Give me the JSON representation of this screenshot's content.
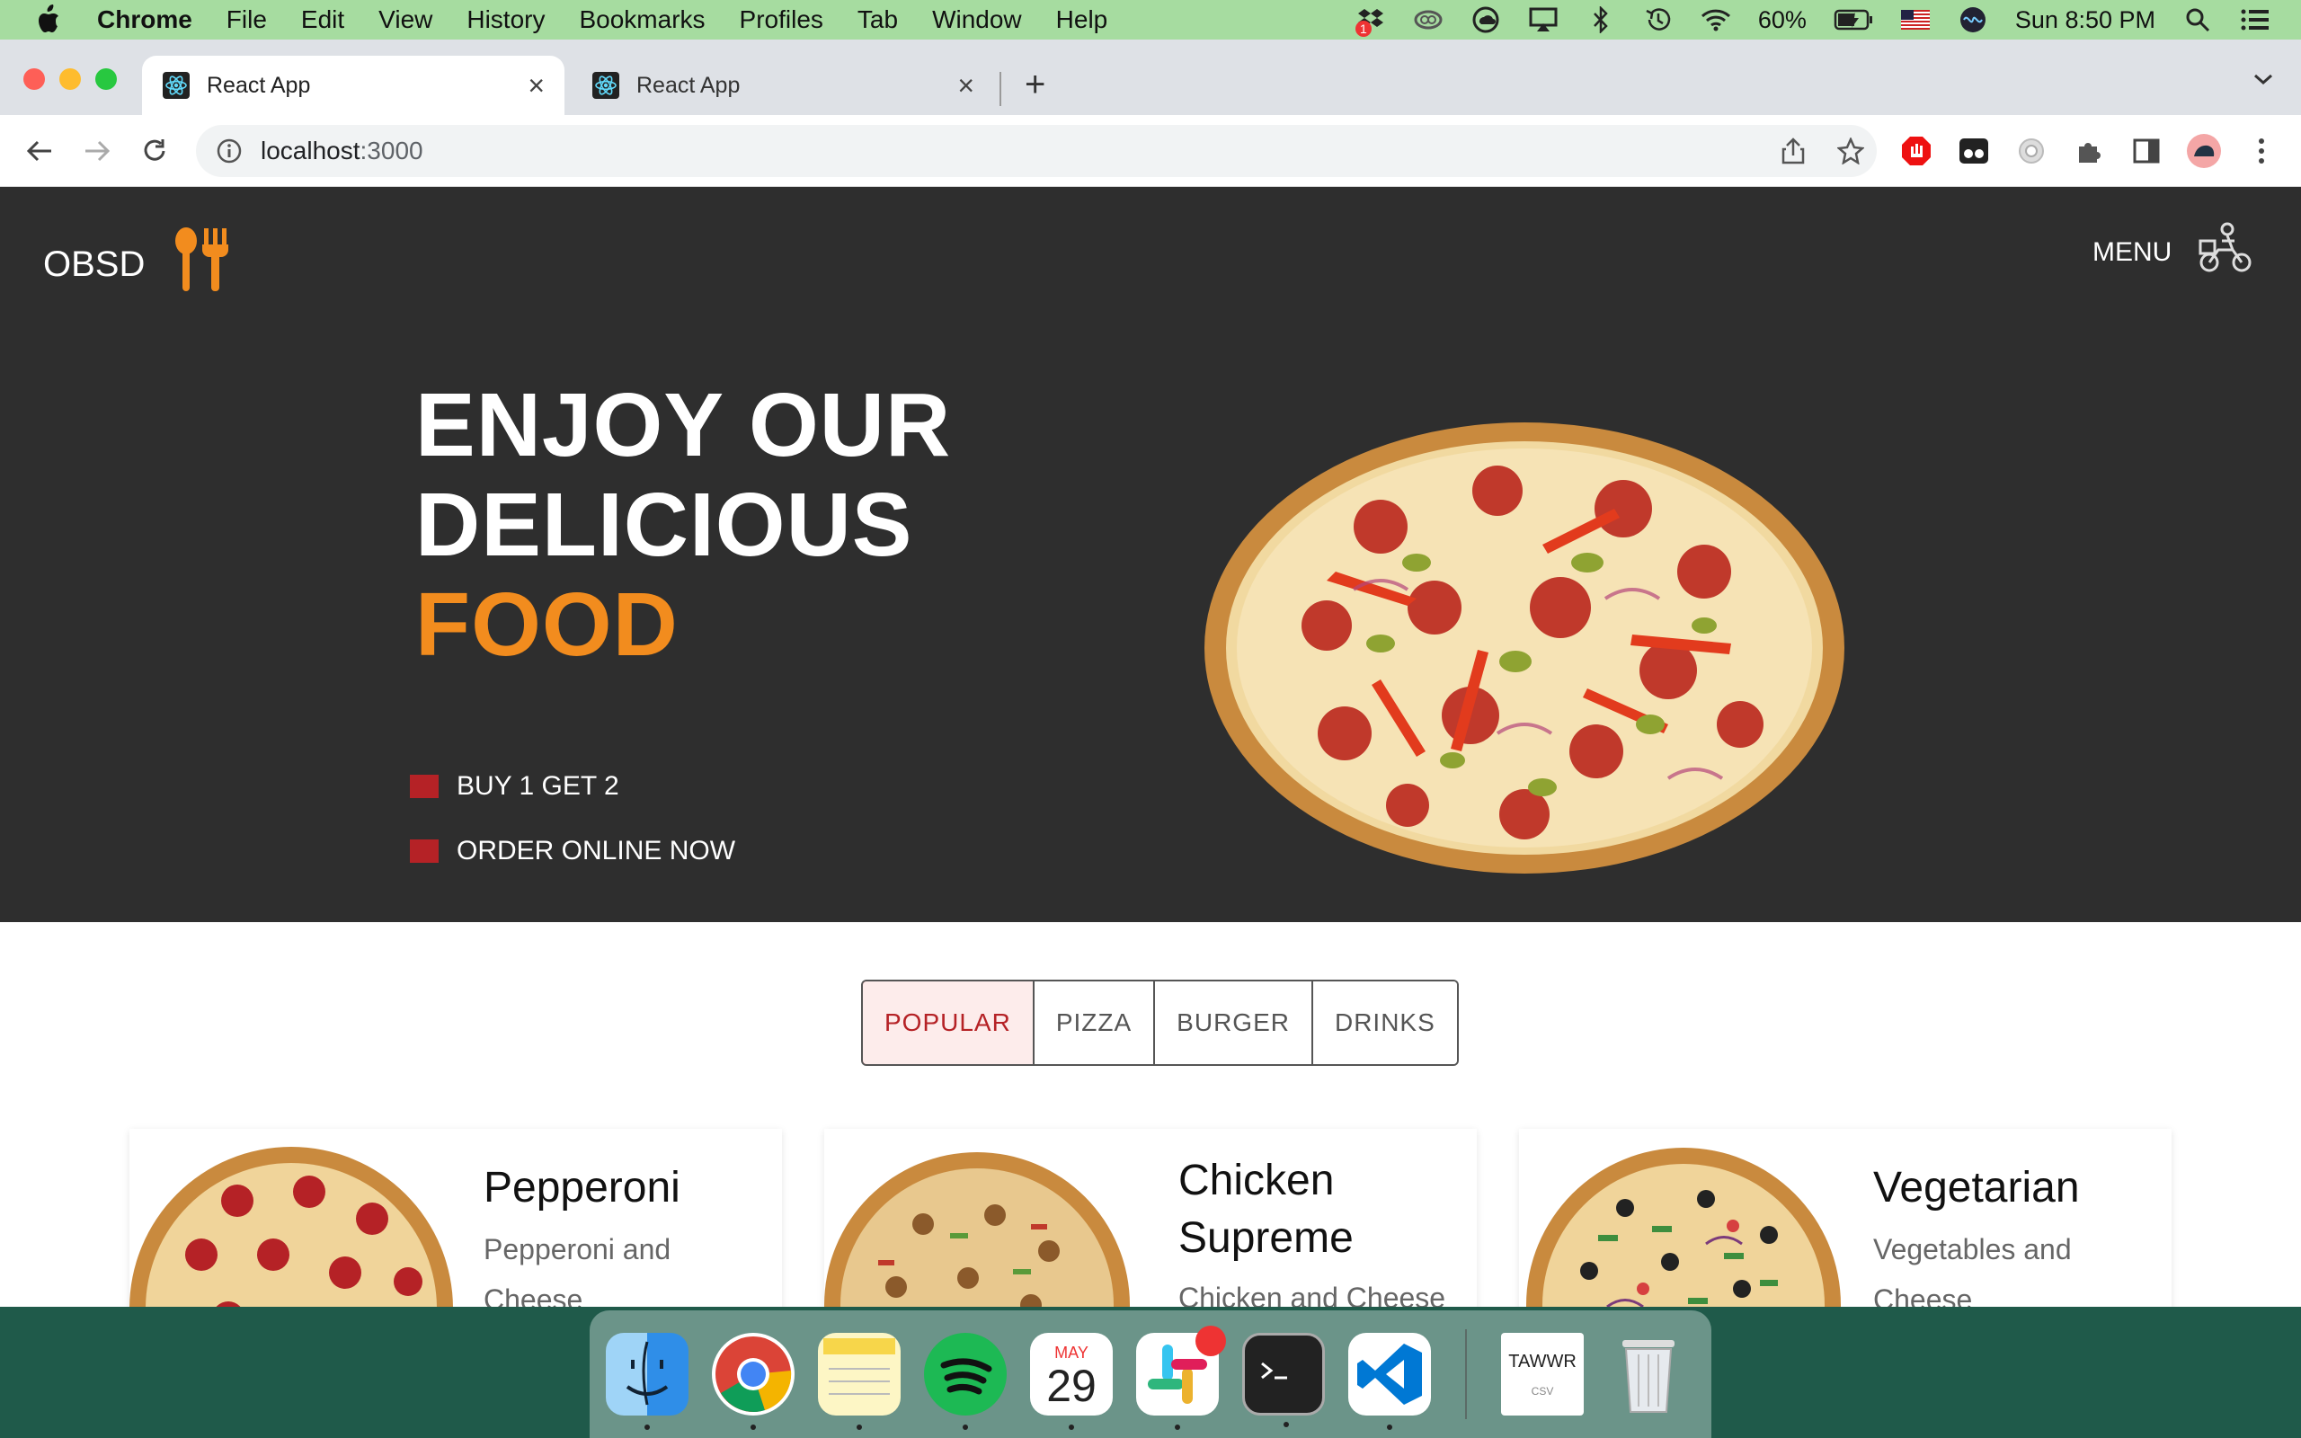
{
  "menubar": {
    "app_name": "Chrome",
    "menus": [
      "File",
      "Edit",
      "View",
      "History",
      "Bookmarks",
      "Profiles",
      "Tab",
      "Window",
      "Help"
    ],
    "battery": "60%",
    "datetime": "Sun 8:50 PM",
    "dropbox_badge": "1"
  },
  "browser": {
    "tabs": [
      {
        "title": "React App",
        "active": true
      },
      {
        "title": "React App",
        "active": false
      }
    ],
    "url_host": "localhost",
    "url_port": ":3000"
  },
  "site": {
    "brand": "OBSD",
    "menu_label": "MENU",
    "headline_line1": "ENJOY OUR",
    "headline_line2": "DELICIOUS",
    "headline_accent": "FOOD",
    "bullets": [
      "BUY 1 GET 2",
      "ORDER ONLINE NOW"
    ],
    "accent_color": "#f28c1e",
    "bullet_color": "#b52226",
    "filters": [
      {
        "label": "POPULAR",
        "active": true
      },
      {
        "label": "PIZZA",
        "active": false
      },
      {
        "label": "BURGER",
        "active": false
      },
      {
        "label": "DRINKS",
        "active": false
      }
    ],
    "cards": [
      {
        "title": "Pepperoni",
        "desc_line1": "Pepperoni and",
        "desc_line2": "Cheese"
      },
      {
        "title_line1": "Chicken",
        "title_line2": "Supreme",
        "desc_line1": "Chicken and Cheese"
      },
      {
        "title": "Vegetarian",
        "desc_line1": "Vegetables and",
        "desc_line2": "Cheese"
      }
    ]
  },
  "dock": {
    "apps": [
      "Finder",
      "Google Chrome",
      "Notes",
      "Spotify",
      "Calendar",
      "Slack",
      "Terminal",
      "Visual Studio Code",
      "Tawwr Document",
      "Trash"
    ],
    "calendar_month": "MAY",
    "calendar_day": "29",
    "document_label": "TAWWR",
    "document_ext": "CSV"
  }
}
